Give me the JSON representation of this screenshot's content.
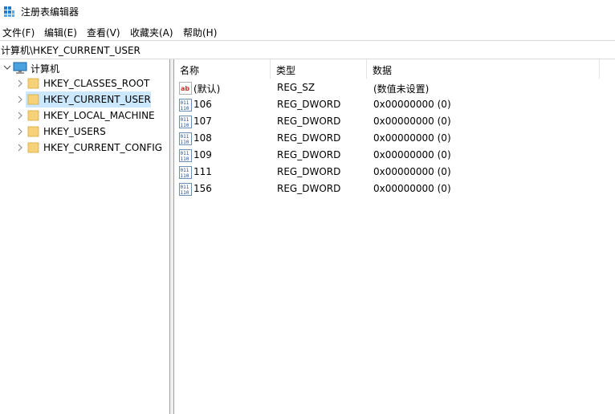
{
  "window": {
    "title": "注册表编辑器",
    "icon": "registry-editor-icon"
  },
  "menu": [
    {
      "label": "文件(F)"
    },
    {
      "label": "编辑(E)"
    },
    {
      "label": "查看(V)"
    },
    {
      "label": "收藏夹(A)"
    },
    {
      "label": "帮助(H)"
    }
  ],
  "address": "计算机\\HKEY_CURRENT_USER",
  "tree": {
    "root": {
      "label": "计算机",
      "icon": "computer-icon"
    },
    "children": [
      {
        "label": "HKEY_CLASSES_ROOT"
      },
      {
        "label": "HKEY_CURRENT_USER",
        "selected": true
      },
      {
        "label": "HKEY_LOCAL_MACHINE"
      },
      {
        "label": "HKEY_USERS"
      },
      {
        "label": "HKEY_CURRENT_CONFIG"
      }
    ]
  },
  "columns": {
    "name": "名称",
    "type": "类型",
    "data": "数据"
  },
  "values": [
    {
      "name": "(默认)",
      "type": "REG_SZ",
      "data": "(数值未设置)",
      "icon": "string-value-icon"
    },
    {
      "name": "106",
      "type": "REG_DWORD",
      "data": "0x00000000 (0)",
      "icon": "binary-value-icon"
    },
    {
      "name": "107",
      "type": "REG_DWORD",
      "data": "0x00000000 (0)",
      "icon": "binary-value-icon"
    },
    {
      "name": "108",
      "type": "REG_DWORD",
      "data": "0x00000000 (0)",
      "icon": "binary-value-icon"
    },
    {
      "name": "109",
      "type": "REG_DWORD",
      "data": "0x00000000 (0)",
      "icon": "binary-value-icon"
    },
    {
      "name": "111",
      "type": "REG_DWORD",
      "data": "0x00000000 (0)",
      "icon": "binary-value-icon"
    },
    {
      "name": "156",
      "type": "REG_DWORD",
      "data": "0x00000000 (0)",
      "icon": "binary-value-icon"
    }
  ],
  "colors": {
    "selection": "#cce8ff",
    "folder": "#f5d27a"
  }
}
